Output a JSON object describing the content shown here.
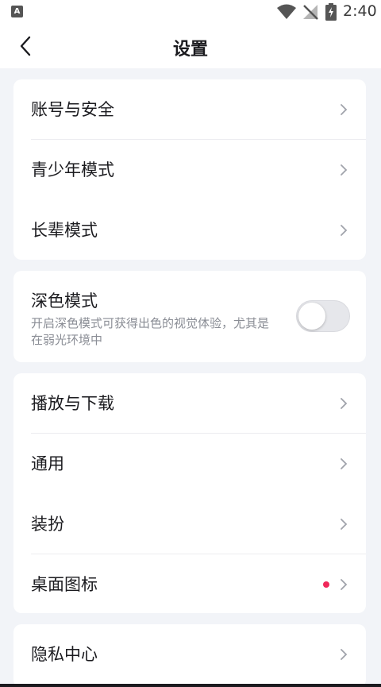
{
  "status_bar": {
    "app_icon_letter": "A",
    "time": "2:40",
    "icons": [
      "wifi-icon",
      "no-signal-icon",
      "battery-charging-icon"
    ]
  },
  "header": {
    "title": "设置",
    "back_icon": "back-arrow-icon"
  },
  "groups": {
    "account": {
      "items": [
        {
          "label": "账号与安全"
        },
        {
          "label": "青少年模式"
        },
        {
          "label": "长辈模式"
        }
      ]
    },
    "dark_mode": {
      "title": "深色模式",
      "description": "开启深色模式可获得出色的视觉体验，尤其是在弱光环境中",
      "enabled": false
    },
    "general": {
      "items": [
        {
          "label": "播放与下载"
        },
        {
          "label": "通用"
        },
        {
          "label": "装扮"
        },
        {
          "label": "桌面图标",
          "badge": "red-dot"
        }
      ]
    },
    "privacy": {
      "items": [
        {
          "label": "隐私中心"
        }
      ]
    }
  },
  "colors": {
    "background": "#f2f4f8",
    "card": "#ffffff",
    "text_primary": "#1b1b1f",
    "text_secondary": "#8a8d95",
    "badge_red": "#f0285a",
    "chevron": "#a0a3ab"
  }
}
